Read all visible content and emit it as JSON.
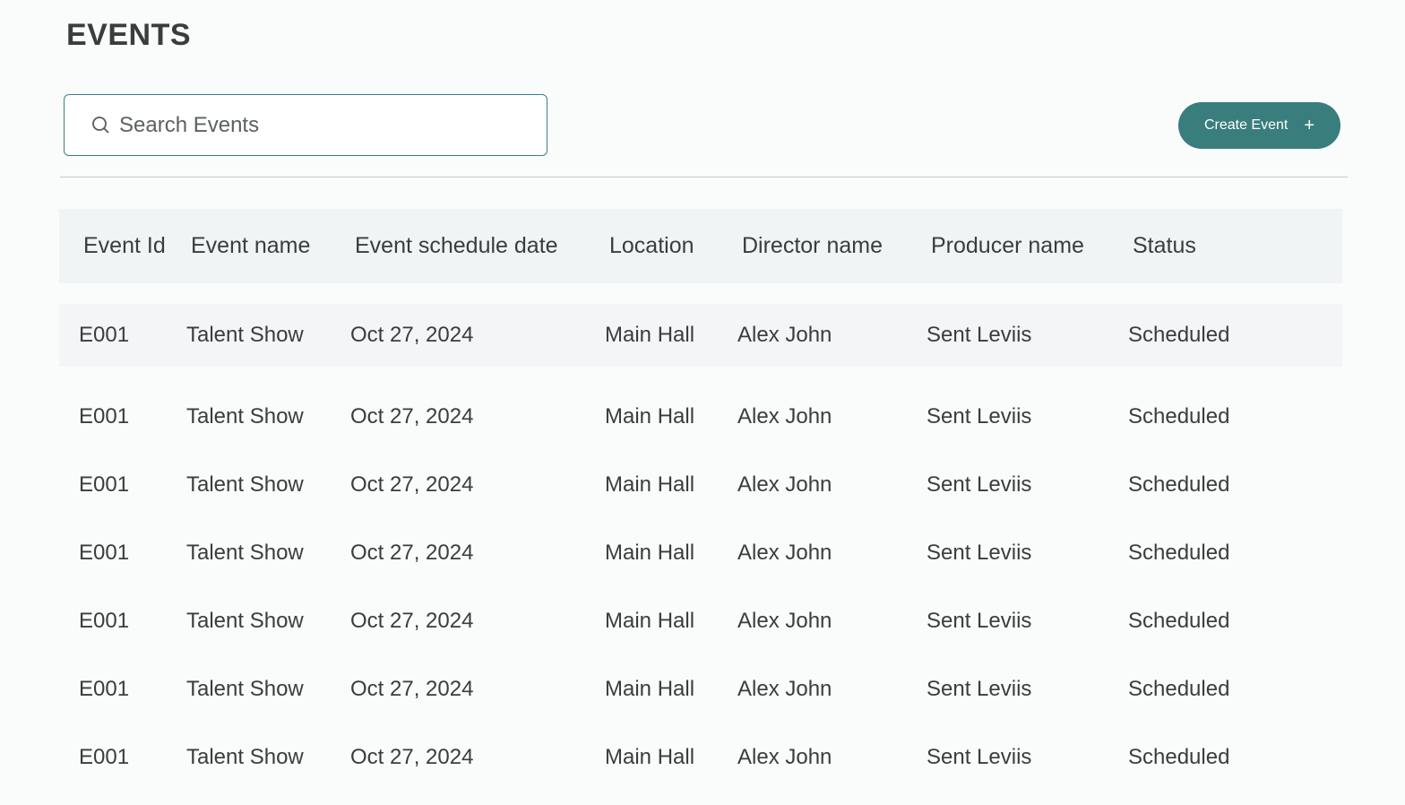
{
  "page": {
    "title": "EVENTS"
  },
  "search": {
    "placeholder": "Search Events",
    "icon": "search-icon"
  },
  "toolbar": {
    "create_label": "Create Event",
    "create_icon": "+"
  },
  "colors": {
    "accent": "#3a7d7d",
    "header_bg": "#f1f4f5",
    "background": "#fafbfb"
  },
  "table": {
    "columns": [
      "Event Id",
      "Event name",
      "Event schedule date",
      "Location",
      "Director name",
      "Producer name",
      "Status"
    ],
    "rows": [
      [
        "E001",
        "Talent Show",
        "Oct 27, 2024",
        "Main Hall",
        "Alex John",
        "Sent Leviis",
        "Scheduled"
      ],
      [
        "E001",
        "Talent Show",
        "Oct 27, 2024",
        "Main Hall",
        "Alex John",
        "Sent Leviis",
        "Scheduled"
      ],
      [
        "E001",
        "Talent Show",
        "Oct 27, 2024",
        "Main Hall",
        "Alex John",
        "Sent Leviis",
        "Scheduled"
      ],
      [
        "E001",
        "Talent Show",
        "Oct 27, 2024",
        "Main Hall",
        "Alex John",
        "Sent Leviis",
        "Scheduled"
      ],
      [
        "E001",
        "Talent Show",
        "Oct 27, 2024",
        "Main Hall",
        "Alex John",
        "Sent Leviis",
        "Scheduled"
      ],
      [
        "E001",
        "Talent Show",
        "Oct 27, 2024",
        "Main Hall",
        "Alex John",
        "Sent Leviis",
        "Scheduled"
      ],
      [
        "E001",
        "Talent Show",
        "Oct 27, 2024",
        "Main Hall",
        "Alex John",
        "Sent Leviis",
        "Scheduled"
      ]
    ]
  }
}
